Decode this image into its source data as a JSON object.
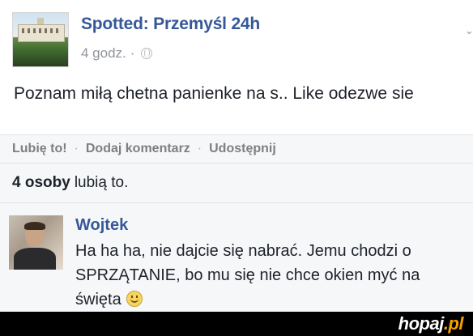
{
  "post": {
    "page_name": "Spotted: Przemyśl 24h",
    "time": "4 godz.",
    "separator": "·",
    "icons": {
      "audience": "globe-icon",
      "menu": "chevron-down-icon"
    },
    "text": "Poznam miłą chetna panienke na s.. Like odezwe sie"
  },
  "actions": {
    "like": "Lubię to!",
    "sep1": "·",
    "comment": "Dodaj komentarz",
    "sep2": "·",
    "share": "Udostępnij"
  },
  "likes": {
    "count": "4 osoby",
    "text": "lubią to."
  },
  "comment": {
    "author": "Wojtek",
    "text": "Ha ha ha, nie dajcie się nabrać. Jemu chodzi o\nSPRZĄTANIE, bo mu się nie chce okien myć na\nświęta",
    "emoji": "smiley-icon"
  },
  "watermark": {
    "name": "hopaj",
    "suffix": ".pl"
  },
  "colors": {
    "link": "#365899",
    "muted": "#90949c",
    "panel": "#f6f7f9",
    "watermark_accent": "#f5a000"
  }
}
